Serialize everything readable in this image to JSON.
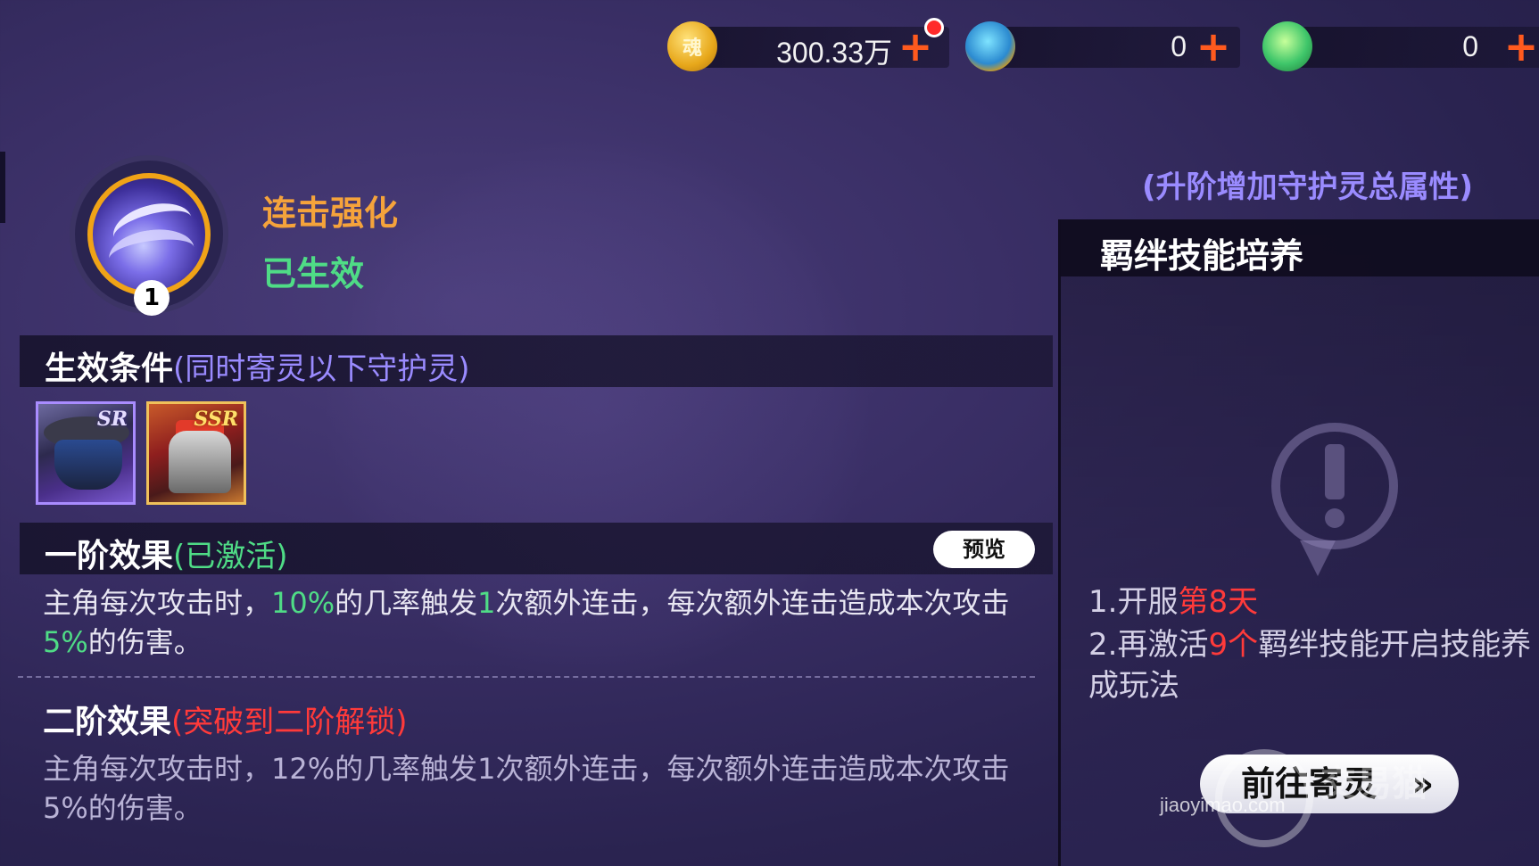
{
  "currencies": [
    {
      "name": "gold",
      "icon": "gold-coin-icon",
      "value": "300.33万",
      "coin_glyph": "魂",
      "has_alert": true
    },
    {
      "name": "blue-token",
      "icon": "dragon-medal-icon",
      "value": "0",
      "coin_glyph": "",
      "has_alert": false
    },
    {
      "name": "green-token",
      "icon": "green-spirit-icon",
      "value": "0",
      "coin_glyph": "",
      "has_alert": false
    }
  ],
  "plus_label": "+",
  "skill": {
    "name": "连击强化",
    "status": "已生效",
    "level": "1",
    "icon": "crescent-moon-skill-icon"
  },
  "condition": {
    "title": "生效条件",
    "subtitle": "(同时寄灵以下守护灵)",
    "cards": [
      {
        "rarity": "SR",
        "icon": "ninja-guardian-portrait"
      },
      {
        "rarity": "SSR",
        "icon": "red-mecha-guardian-portrait"
      }
    ]
  },
  "effect1": {
    "title": "一阶效果",
    "state": "(已激活)",
    "preview_label": "预览",
    "desc_parts": [
      "主角每次攻击时，",
      "10%",
      "的几率触发",
      "1",
      "次额外连击，每次额外连击造成本次攻击",
      "5%",
      "的伤害。"
    ]
  },
  "effect2": {
    "title": "二阶效果",
    "state": "(突破到二阶解锁)",
    "desc": "主角每次攻击时，12%的几率触发1次额外连击，每次额外连击造成本次攻击5%的伤害。"
  },
  "right_panel": {
    "hint": "(升阶增加守护灵总属性)",
    "title": "羁绊技能培养",
    "warning_icon": "exclamation-bubble-icon",
    "req1_prefix": "1.开服",
    "req1_highlight": "第8天",
    "req2_prefix": "2.再激活",
    "req2_highlight": "9个",
    "req2_suffix": "羁绊技能开启技能养成玩法",
    "goto_label": "前往寄灵",
    "goto_chevron": "»"
  },
  "watermark": {
    "name": "交易猫",
    "url": "jiaoyimao.com"
  },
  "colors": {
    "accent_green": "#4fdc86",
    "accent_orange": "#f5a33b",
    "accent_purple": "#9a8bff",
    "alert_red": "#ff3a3a",
    "plus_orange": "#ff5a1e"
  }
}
